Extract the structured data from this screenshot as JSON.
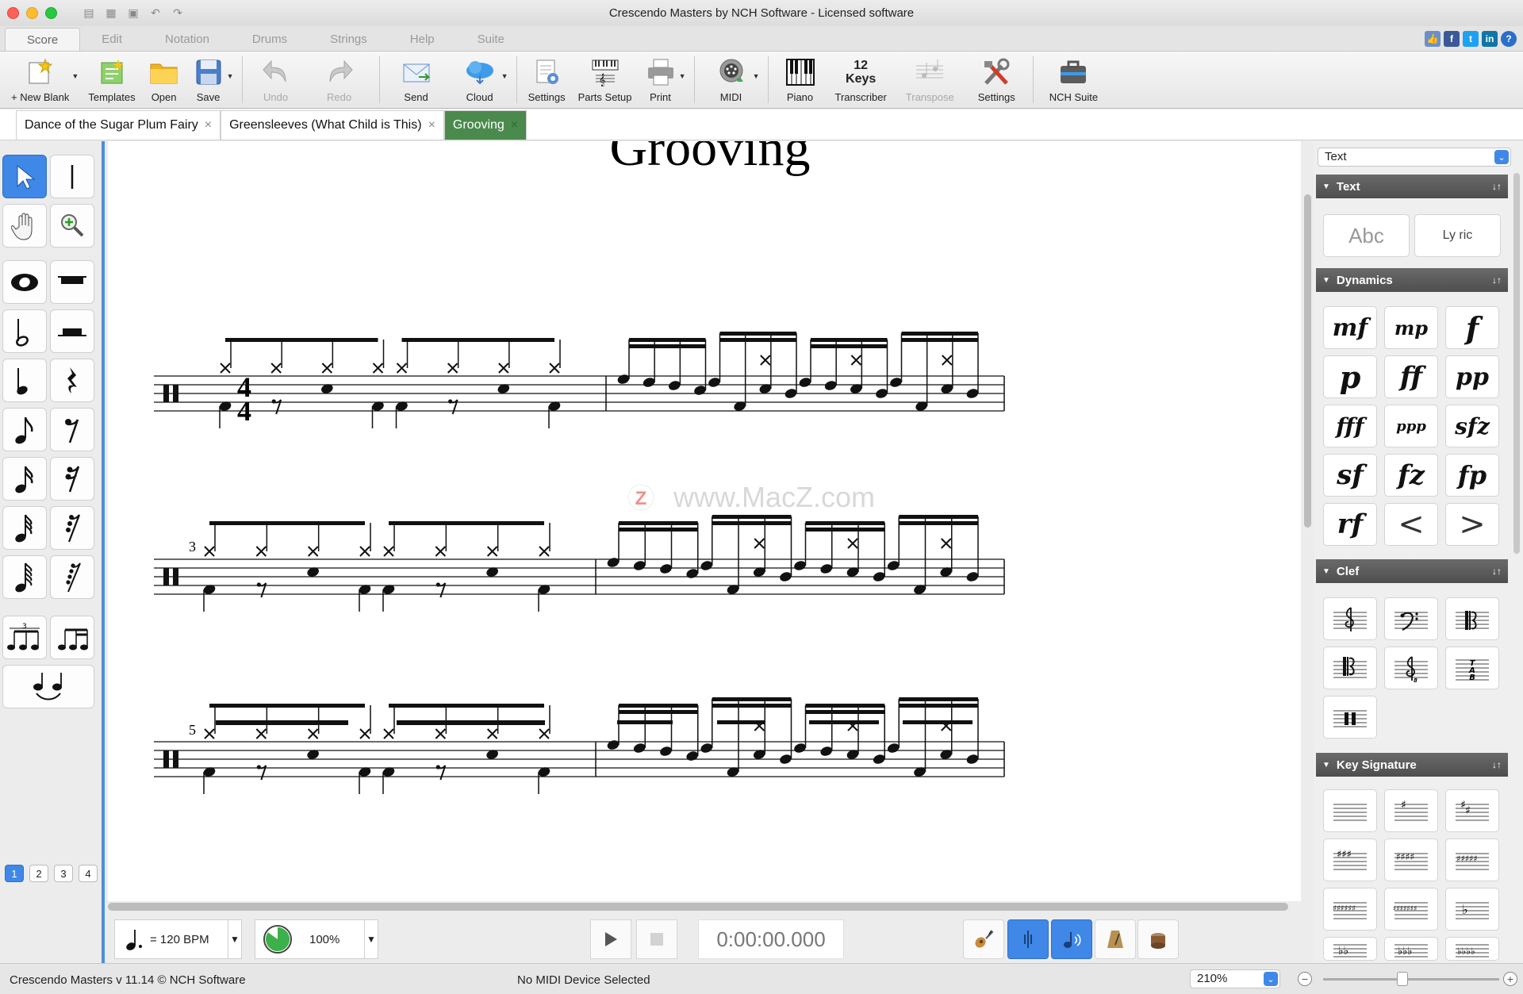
{
  "window": {
    "title": "Crescendo Masters by NCH Software - Licensed software"
  },
  "ribbon_tabs": [
    "Score",
    "Edit",
    "Notation",
    "Drums",
    "Strings",
    "Help",
    "Suite"
  ],
  "toolbar": [
    {
      "label": "+ New Blank",
      "icon": "new-blank-icon"
    },
    {
      "label": "Templates",
      "icon": "templates-icon"
    },
    {
      "label": "Open",
      "icon": "open-folder-icon"
    },
    {
      "label": "Save",
      "icon": "save-disk-icon"
    },
    {
      "label": "Undo",
      "icon": "undo-icon"
    },
    {
      "label": "Redo",
      "icon": "redo-icon"
    },
    {
      "label": "Send",
      "icon": "send-envelope-icon"
    },
    {
      "label": "Cloud",
      "icon": "cloud-icon"
    },
    {
      "label": "Settings",
      "icon": "settings-document-icon"
    },
    {
      "label": "Parts Setup",
      "icon": "parts-setup-icon"
    },
    {
      "label": "Print",
      "icon": "printer-icon"
    },
    {
      "label": "MIDI",
      "icon": "midi-icon"
    },
    {
      "label": "Piano",
      "icon": "piano-icon"
    },
    {
      "label": "Transcriber",
      "icon": "transcriber-icon",
      "badge_top": "12",
      "badge_bottom": "Keys"
    },
    {
      "label": "Transpose",
      "icon": "transpose-icon"
    },
    {
      "label": "Settings",
      "icon": "tools-icon"
    },
    {
      "label": "NCH Suite",
      "icon": "nch-suite-icon"
    }
  ],
  "doc_tabs": [
    {
      "label": "Dance of the Sugar Plum Fairy",
      "close": "×"
    },
    {
      "label": "Greensleeves (What Child is This)",
      "close": "×"
    },
    {
      "label": "Grooving",
      "close": "×"
    }
  ],
  "score": {
    "title": "Grooving",
    "time_signature_top": "4",
    "time_signature_bottom": "4",
    "measure_numbers": [
      "3",
      "5"
    ],
    "watermark": "www.MacZ.com",
    "watermark_badge": "Z"
  },
  "voices": [
    "1",
    "2",
    "3",
    "4"
  ],
  "right_panel": {
    "selector": "Text",
    "sections": [
      "Text",
      "Dynamics",
      "Clef",
      "Key Signature"
    ],
    "text_items": [
      "Abc",
      "Ly ric"
    ],
    "dynamics": [
      "mf",
      "mp",
      "f",
      "p",
      "ff",
      "pp",
      "fff",
      "ppp",
      "sfz",
      "sf",
      "fz",
      "fp",
      "rf",
      "<",
      ">"
    ]
  },
  "transport": {
    "tempo": "= 120 BPM",
    "volume": "100%",
    "volume_level": 0.85,
    "time": "0:00:00.000"
  },
  "status": {
    "version": "Crescendo Masters v 11.14 © NCH Software",
    "midi": "No MIDI Device Selected",
    "zoom": "210%",
    "zoom_level": 0.45
  },
  "colors": {
    "accent_blue": "#3f88e8",
    "active_tab_green": "#4a8a4c",
    "section_header": "#555555"
  }
}
